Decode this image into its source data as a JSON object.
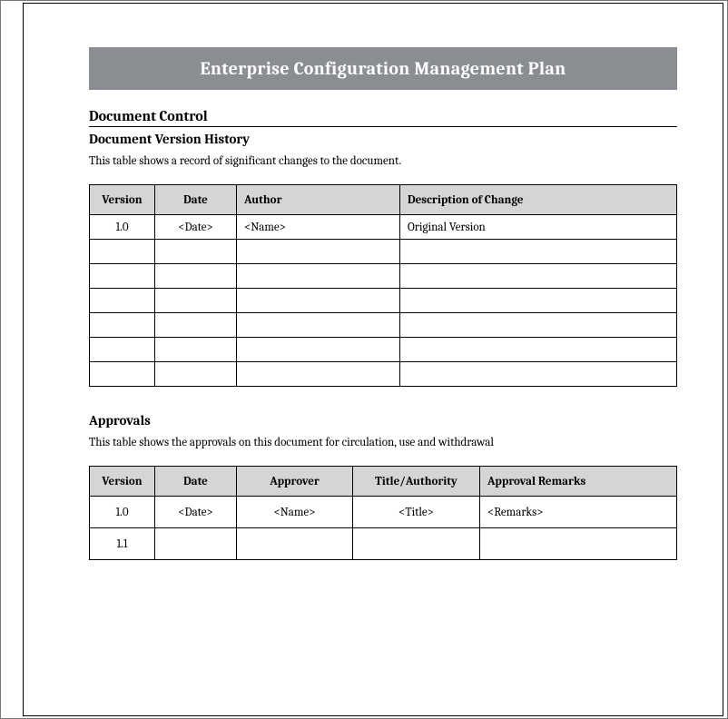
{
  "banner": {
    "title": "Enterprise Configuration Management Plan"
  },
  "section1": {
    "heading": "Document Control",
    "sub1": {
      "heading": "Document Version History",
      "intro": "This table shows a record of significant changes to the document.",
      "table": {
        "headers": {
          "version": "Version",
          "date": "Date",
          "author": "Author",
          "desc": "Description of Change"
        },
        "rows": [
          {
            "version": "1.0",
            "date": "<Date>",
            "author": "<Name>",
            "desc": "Original Version"
          },
          {
            "version": "",
            "date": "",
            "author": "",
            "desc": ""
          },
          {
            "version": "",
            "date": "",
            "author": "",
            "desc": ""
          },
          {
            "version": "",
            "date": "",
            "author": "",
            "desc": ""
          },
          {
            "version": "",
            "date": "",
            "author": "",
            "desc": ""
          },
          {
            "version": "",
            "date": "",
            "author": "",
            "desc": ""
          },
          {
            "version": "",
            "date": "",
            "author": "",
            "desc": ""
          }
        ]
      }
    },
    "sub2": {
      "heading": "Approvals",
      "intro": "This table shows the approvals on this document for circulation, use and withdrawal",
      "table": {
        "headers": {
          "version": "Version",
          "date": "Date",
          "approver": "Approver",
          "title": "Title/Authority",
          "remarks": "Approval Remarks"
        },
        "rows": [
          {
            "version": "1.0",
            "date": "<Date>",
            "approver": "<Name>",
            "title": "<Title>",
            "remarks": "<Remarks>"
          },
          {
            "version": "1.1",
            "date": "",
            "approver": "",
            "title": "",
            "remarks": ""
          }
        ]
      }
    }
  }
}
